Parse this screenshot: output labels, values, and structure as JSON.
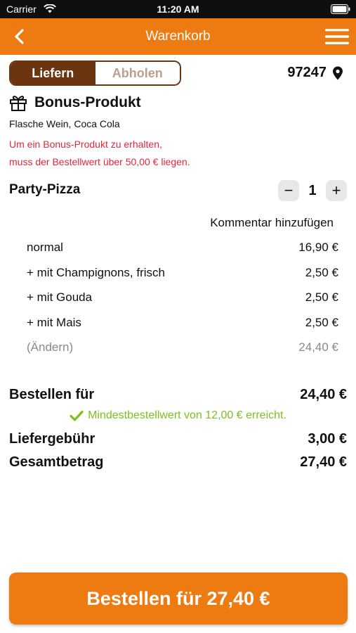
{
  "status_bar": {
    "carrier": "Carrier",
    "time": "11:20 AM"
  },
  "nav": {
    "title": "Warenkorb"
  },
  "delivery_toggle": {
    "options": [
      "Liefern",
      "Abholen"
    ],
    "selected": "Liefern"
  },
  "zip_code": "97247",
  "bonus": {
    "title": "Bonus-Produkt",
    "items": "Flasche Wein, Coca Cola",
    "note_line1": "Um ein Bonus-Produkt zu erhalten,",
    "note_line2": "muss der Bestellwert über 50,00 € liegen."
  },
  "product": {
    "name": "Party-Pizza",
    "quantity": "1",
    "comment_label": "Kommentar hinzufügen",
    "lines": [
      {
        "label": "normal",
        "price": "16,90 €"
      },
      {
        "label": "+ mit Champignons, frisch",
        "price": "2,50 €"
      },
      {
        "label": "+ mit Gouda",
        "price": "2,50 €"
      },
      {
        "label": "+ mit Mais",
        "price": "2,50 €"
      },
      {
        "label": "(Ändern)",
        "price": "24,40 €"
      }
    ]
  },
  "totals": {
    "order_for_label": "Bestellen für",
    "order_for_value": "24,40 €",
    "min_order_text": "Mindestbestellwert von 12,00 € erreicht.",
    "delivery_fee_label": "Liefergebühr",
    "delivery_fee_value": "3,00 €",
    "total_label": "Gesamtbetrag",
    "total_value": "27,40 €"
  },
  "order_button": {
    "label": "Bestellen für 27,40 €"
  },
  "colors": {
    "accent": "#ee7a12",
    "toggle_active": "#6a3510",
    "warning": "#e2273c",
    "success": "#7fbf1d"
  }
}
